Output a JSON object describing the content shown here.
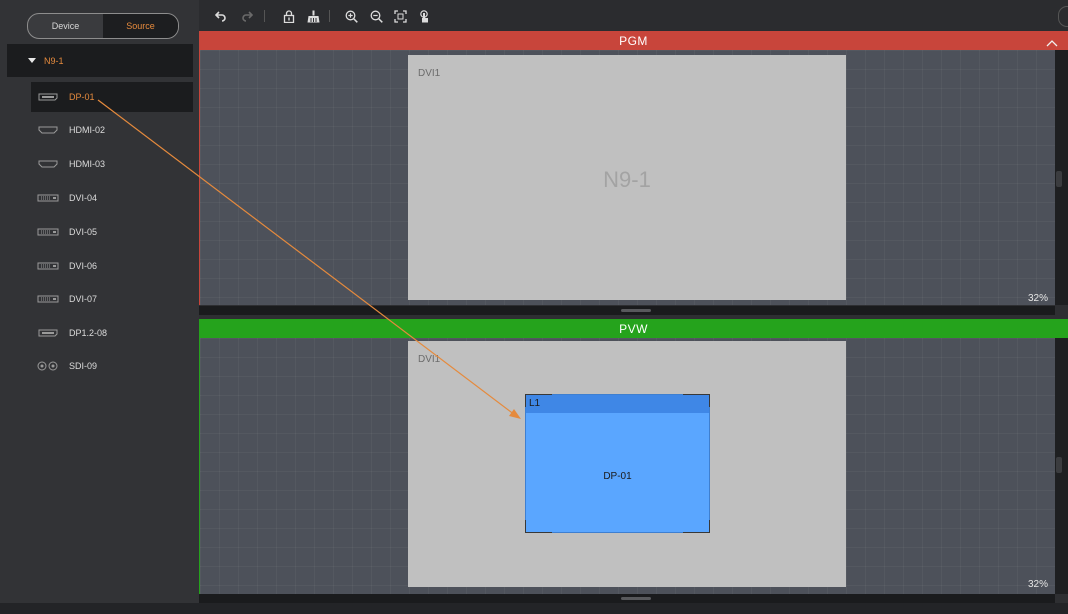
{
  "sidebar": {
    "tabs": {
      "device": "Device",
      "source": "Source"
    },
    "tree_root": "N9-1",
    "sources": [
      {
        "label": "DP-01",
        "icon": "dp-port-icon",
        "selected": true
      },
      {
        "label": "HDMI-02",
        "icon": "hdmi-port-icon"
      },
      {
        "label": "HDMI-03",
        "icon": "hdmi-port-icon"
      },
      {
        "label": "DVI-04",
        "icon": "dvi-port-icon"
      },
      {
        "label": "DVI-05",
        "icon": "dvi-port-icon"
      },
      {
        "label": "DVI-06",
        "icon": "dvi-port-icon"
      },
      {
        "label": "DVI-07",
        "icon": "dvi-port-icon"
      },
      {
        "label": "DP1.2-08",
        "icon": "dp-port-icon"
      },
      {
        "label": "SDI-09",
        "icon": "sdi-port-icon"
      }
    ]
  },
  "toolbar": {
    "icons": [
      "undo-icon",
      "redo-icon",
      "lock-icon",
      "clear-icon",
      "zoom-in-icon",
      "zoom-out-icon",
      "fit-screen-icon",
      "touch-icon"
    ]
  },
  "pgm": {
    "title": "PGM",
    "screen_label": "DVI1",
    "screen_name": "N9-1",
    "zoom": "32%"
  },
  "pvw": {
    "title": "PVW",
    "screen_label": "DVI1",
    "zoom": "32%",
    "layer": {
      "name": "L1",
      "source": "DP-01"
    }
  },
  "colors": {
    "accent": "#e58a3d",
    "pgm": "#c8453b",
    "pvw": "#25a31c",
    "layer": "#5aa6ff"
  }
}
